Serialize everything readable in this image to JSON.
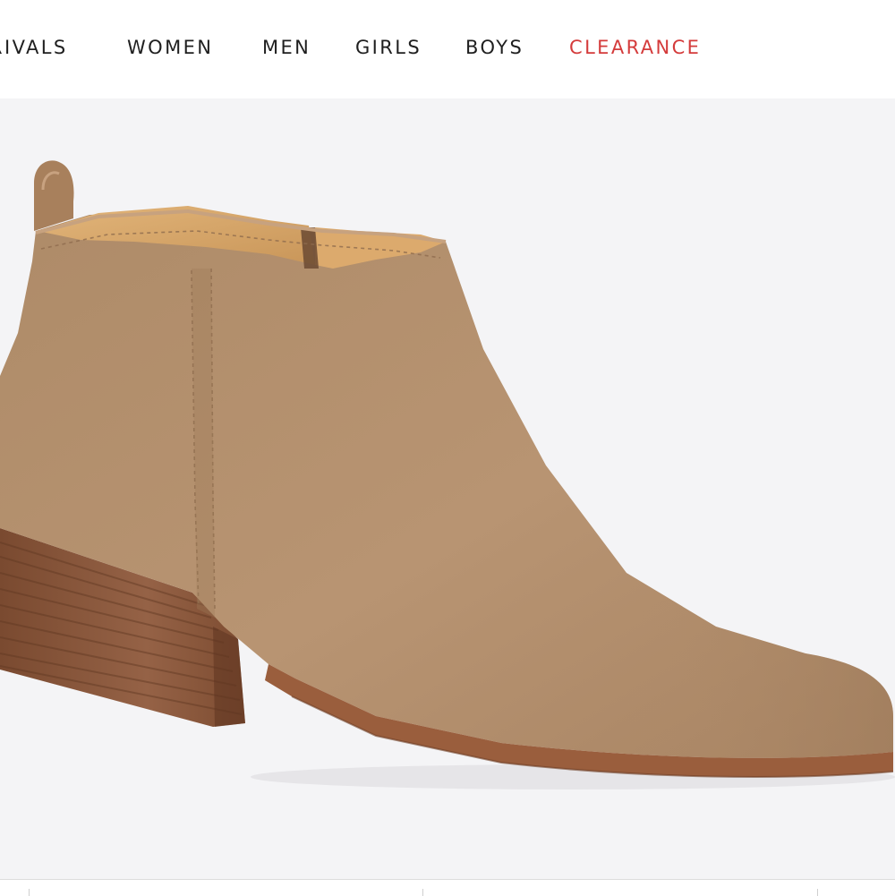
{
  "nav": {
    "items": [
      {
        "label": "RIVALS",
        "highlight": false
      },
      {
        "label": "WOMEN",
        "highlight": false
      },
      {
        "label": "MEN",
        "highlight": false
      },
      {
        "label": "GIRLS",
        "highlight": false
      },
      {
        "label": "BOYS",
        "highlight": false
      },
      {
        "label": "CLEARANCE",
        "highlight": true
      }
    ]
  },
  "product": {
    "image_subject": "suede ankle boot"
  },
  "colors": {
    "nav_text": "#1f1f1f",
    "clearance": "#d43b3b",
    "suede": "#b38f6c",
    "heel_wood": "#8a5a3c",
    "sole": "#9a5e3d",
    "background": "#f4f4f6"
  }
}
